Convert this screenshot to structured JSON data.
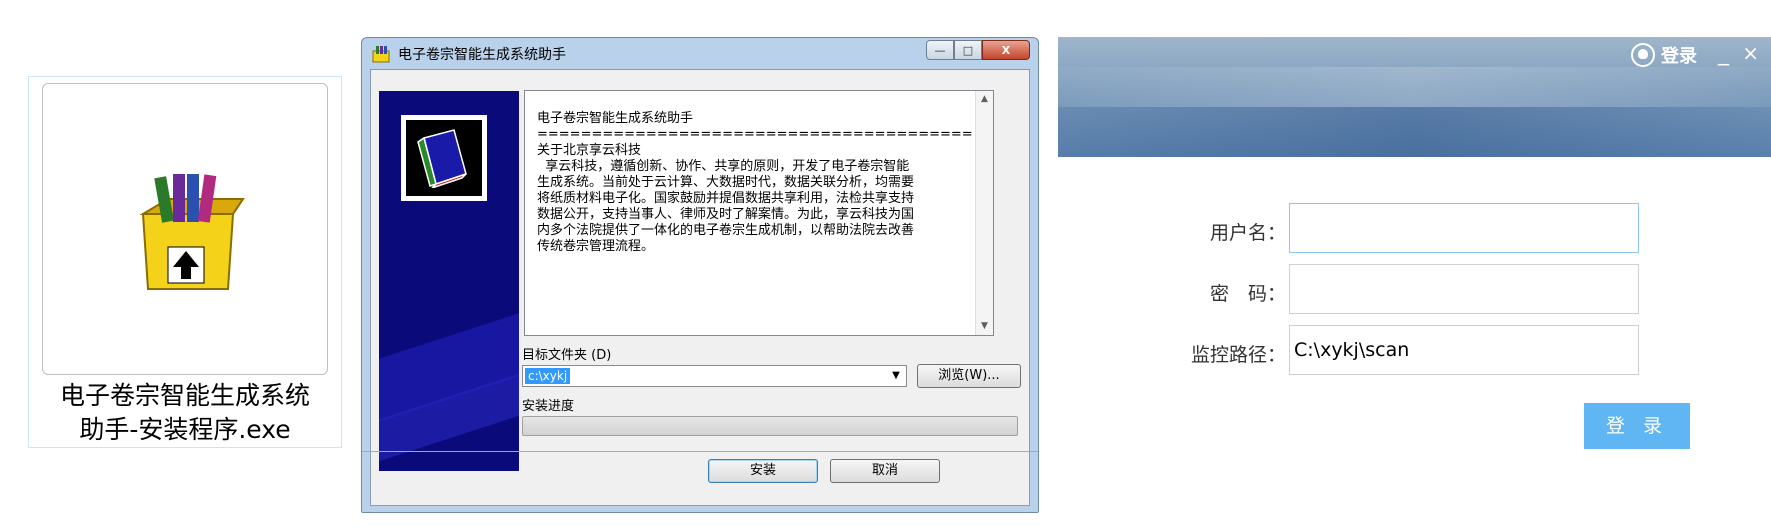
{
  "file_icon": {
    "name_line1": "电子卷宗智能生成系统",
    "name_line2": "助手-安装程序.exe"
  },
  "installer": {
    "window_title": "电子卷宗智能生成系统助手",
    "minimize": "—",
    "maximize": "□",
    "close": "X",
    "info_text": "电子卷宗智能生成系统助手\n========================================\n关于北京享云科技\n  享云科技，遵循创新、协作、共享的原则，开发了电子卷宗智能\n生成系统。当前处于云计算、大数据时代，数据关联分析，均需要\n将纸质材料电子化。国家鼓励并提倡数据共享利用，法检共享支持\n数据公开，支持当事人、律师及时了解案情。为此，享云科技为国\n内多个法院提供了一体化的电子卷宗生成机制，以帮助法院去改善\n传统卷宗管理流程。",
    "dest_label": "目标文件夹 (D)",
    "dest_value": "c:\\xykj",
    "browse_label": "浏览(W)...",
    "progress_label": "安装进度",
    "progress": 0,
    "install_label": "安装",
    "cancel_label": "取消"
  },
  "login": {
    "header_title": "登录",
    "minimize": "_",
    "close": "×",
    "username_label": "用户名：",
    "username_value": "",
    "password_label": "密　码：",
    "password_value": "",
    "path_label": "监控路径：",
    "path_value": "C:\\xykj\\scan",
    "login_button": "登 录"
  }
}
